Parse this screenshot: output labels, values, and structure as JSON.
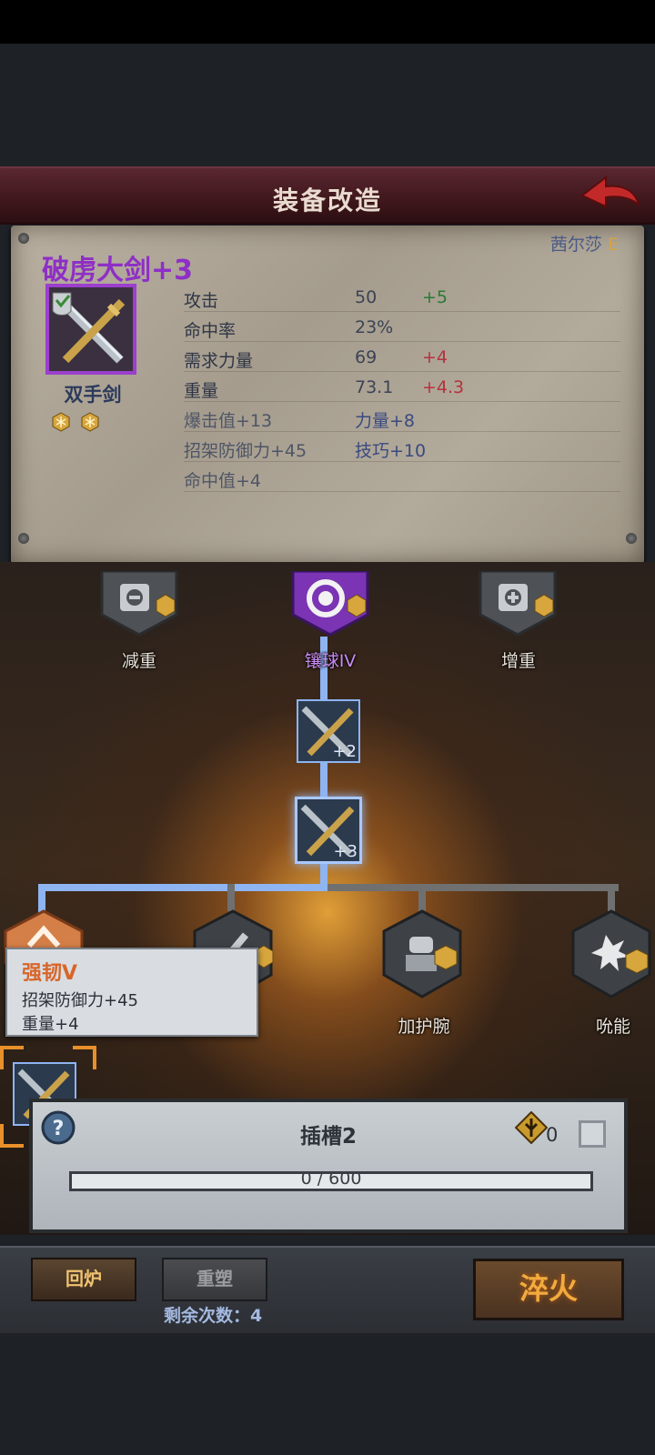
{
  "header": {
    "title": "装备改造"
  },
  "equipment": {
    "owner": "茜尔莎",
    "owner_grade": "E",
    "name": "破虏大剑+3",
    "type": "双手剑",
    "stats": [
      {
        "label": "攻击",
        "value": "50",
        "delta": "+5",
        "delta_kind": "plus"
      },
      {
        "label": "命中率",
        "value": "23%",
        "delta": "",
        "delta_kind": ""
      },
      {
        "label": "需求力量",
        "value": "69",
        "delta": "+4",
        "delta_kind": "minus"
      },
      {
        "label": "重量",
        "value": "73.1",
        "delta": "+4.3",
        "delta_kind": "minus"
      }
    ],
    "bonuses": [
      {
        "left": "爆击值+13",
        "right": "力量+8"
      },
      {
        "left": "招架防御力+45",
        "right": "技巧+10"
      },
      {
        "left": "命中值+4",
        "right": ""
      }
    ]
  },
  "tree": {
    "top_nodes": [
      {
        "label": "减重",
        "icon": "weight-down-icon"
      },
      {
        "label": "镶球IV",
        "icon": "orb-socket-icon"
      },
      {
        "label": "增重",
        "icon": "weight-up-icon"
      }
    ],
    "upgrade_nodes": [
      {
        "level": "+2"
      },
      {
        "level": "+3"
      }
    ],
    "bottom_nodes": [
      {
        "label": "强韧V",
        "icon": "toughness-icon"
      },
      {
        "label": "",
        "icon": "slash-icon"
      },
      {
        "label": "加护腕",
        "icon": "bracer-fist-icon"
      },
      {
        "label": "吮能",
        "icon": "drain-burst-icon"
      }
    ]
  },
  "tooltip": {
    "title": "强韧V",
    "lines": [
      "招架防御力+45",
      "重量+4"
    ]
  },
  "slot": {
    "title": "插槽2",
    "currency_count": "0",
    "progress_text": "0 / 600",
    "progress": 0
  },
  "bottom": {
    "recycle_label": "回炉",
    "reshape_label": "重塑",
    "remaining_text": "剩余次数：4",
    "quench_label": "淬火"
  },
  "colors": {
    "equip_name": "#8e2fc6",
    "plus": "#2a7a33",
    "minus": "#b4323e",
    "tree_line": "#8eb4f2",
    "quench": "#f2ab3e"
  }
}
